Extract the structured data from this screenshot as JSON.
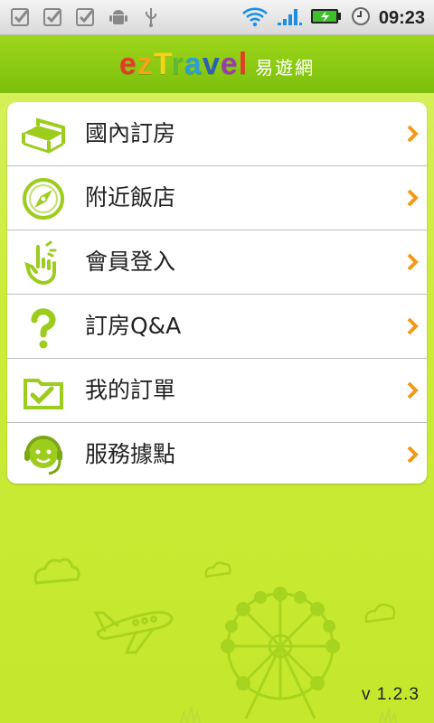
{
  "status_bar": {
    "time": "09:23",
    "left_icons": [
      "checkbox-icon",
      "checkbox-icon",
      "checkbox-icon",
      "android-icon",
      "usb-icon"
    ],
    "right_icons": [
      "wifi-icon",
      "signal-icon",
      "battery-charging-icon",
      "alarm-clock-icon"
    ]
  },
  "header": {
    "logo_text": "ezTravel",
    "logo_letter_colors": [
      "#e8382a",
      "#f2a518",
      "#f6d21b",
      "#5fb836",
      "#2a9fd8",
      "#2b5fb8",
      "#9b3bb0",
      "#e8382a"
    ],
    "logo_subtitle": "易遊網",
    "bar_color": "#8ccb14"
  },
  "menu": {
    "items": [
      {
        "label": "國內訂房",
        "icon": "bed-icon"
      },
      {
        "label": "附近飯店",
        "icon": "compass-icon"
      },
      {
        "label": "會員登入",
        "icon": "hand-tap-icon"
      },
      {
        "label": "訂房Q&A",
        "icon": "question-icon"
      },
      {
        "label": "我的訂單",
        "icon": "folder-check-icon"
      },
      {
        "label": "服務據點",
        "icon": "headset-agent-icon"
      }
    ],
    "chevron_color": "#f29a16",
    "icon_color": "#9ccc1c"
  },
  "footer": {
    "version": "v 1.2.3"
  },
  "background_decoration": [
    "cloud-icon",
    "airplane-icon",
    "ferris-wheel-icon",
    "grass-icon"
  ]
}
